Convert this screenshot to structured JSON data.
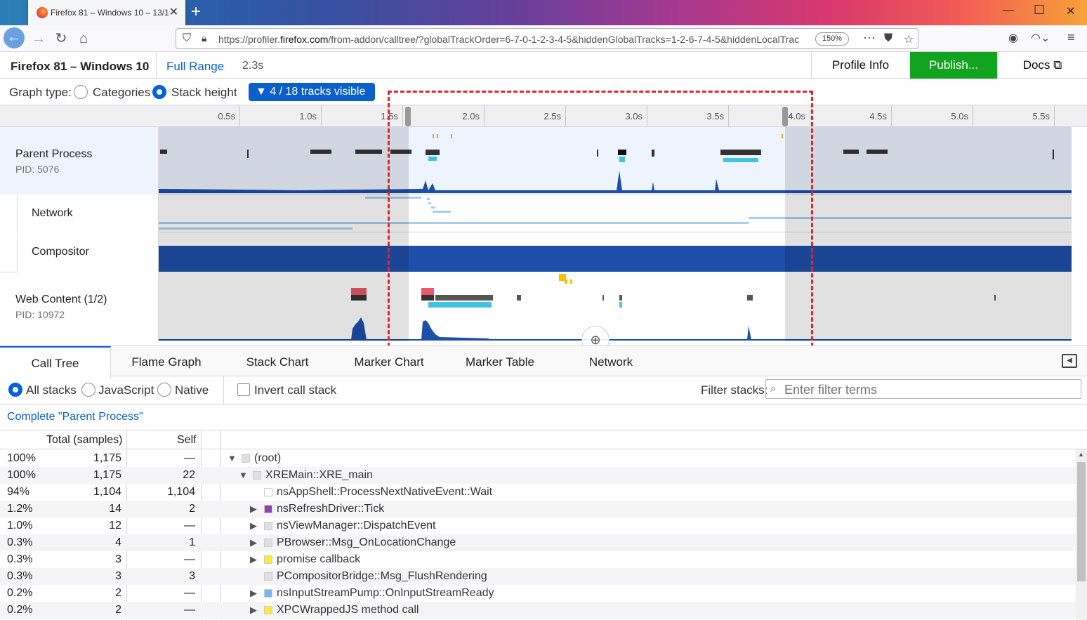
{
  "browser": {
    "tab_title": "Firefox 81 – Windows 10 – 13/1",
    "url_prefix": "https://profiler.",
    "url_host": "firefox.com",
    "url_rest": "/from-addon/calltree/?globalTrackOrder=6-7-0-1-2-3-4-5&hiddenGlobalTracks=1-2-6-7-4-5&hiddenLocalTrac",
    "zoom": "150%"
  },
  "header": {
    "title": "Firefox 81 – Windows 10",
    "full_range": "Full Range",
    "duration": "2.3s",
    "profile_info": "Profile Info",
    "publish": "Publish...",
    "docs": "Docs"
  },
  "graph": {
    "label": "Graph type:",
    "categories": "Categories",
    "stack_height": "Stack height",
    "tracks_visible": "4 / 18 tracks visible"
  },
  "ruler": [
    "0.5s",
    "1.0s",
    "1.5s",
    "2.0s",
    "2.5s",
    "3.0s",
    "3.5s",
    "4.0s",
    "4.5s",
    "5.0s",
    "5.5s"
  ],
  "tracks": {
    "parent": {
      "name": "Parent Process",
      "pid": "PID: 5076"
    },
    "network": {
      "name": "Network"
    },
    "compositor": {
      "name": "Compositor"
    },
    "web": {
      "name": "Web Content (1/2)",
      "pid": "PID: 10972"
    }
  },
  "panel_tabs": [
    "Call Tree",
    "Flame Graph",
    "Stack Chart",
    "Marker Chart",
    "Marker Table",
    "Network"
  ],
  "options": {
    "all_stacks": "All stacks",
    "javascript": "JavaScript",
    "native": "Native",
    "invert": "Invert call stack",
    "filter_label": "Filter stacks:",
    "filter_placeholder": "Enter filter terms"
  },
  "breadcrumb": "Complete \"Parent Process\"",
  "tree_head": {
    "total": "Total (samples)",
    "self": "Self"
  },
  "tree_rows": [
    {
      "pct": "100%",
      "total": "1,175",
      "self": "—",
      "name": "(root)",
      "depth": 0,
      "twisty": "▼",
      "color": "#e0e0e0"
    },
    {
      "pct": "100%",
      "total": "1,175",
      "self": "22",
      "name": "XREMain::XRE_main",
      "depth": 1,
      "twisty": "▼",
      "color": "#e0e0e0"
    },
    {
      "pct": "94%",
      "total": "1,104",
      "self": "1,104",
      "name": "nsAppShell::ProcessNextNativeEvent::Wait",
      "depth": 2,
      "twisty": "",
      "color": "#ffffff"
    },
    {
      "pct": "1.2%",
      "total": "14",
      "self": "2",
      "name": "nsRefreshDriver::Tick",
      "depth": 2,
      "twisty": "▶",
      "color": "#8e44ad"
    },
    {
      "pct": "1.0%",
      "total": "12",
      "self": "—",
      "name": "nsViewManager::DispatchEvent",
      "depth": 2,
      "twisty": "▶",
      "color": "#e0e0e0"
    },
    {
      "pct": "0.3%",
      "total": "4",
      "self": "1",
      "name": "PBrowser::Msg_OnLocationChange",
      "depth": 2,
      "twisty": "▶",
      "color": "#e0e0e0"
    },
    {
      "pct": "0.3%",
      "total": "3",
      "self": "—",
      "name": "promise callback",
      "depth": 2,
      "twisty": "▶",
      "color": "#ffea33"
    },
    {
      "pct": "0.3%",
      "total": "3",
      "self": "3",
      "name": "PCompositorBridge::Msg_FlushRendering",
      "depth": 2,
      "twisty": "",
      "color": "#e0e0e0"
    },
    {
      "pct": "0.2%",
      "total": "2",
      "self": "—",
      "name": "nsInputStreamPump::OnInputStreamReady",
      "depth": 2,
      "twisty": "▶",
      "color": "#78b4f0"
    },
    {
      "pct": "0.2%",
      "total": "2",
      "self": "—",
      "name": "XPCWrappedJS method call",
      "depth": 2,
      "twisty": "▶",
      "color": "#ffea33"
    }
  ]
}
